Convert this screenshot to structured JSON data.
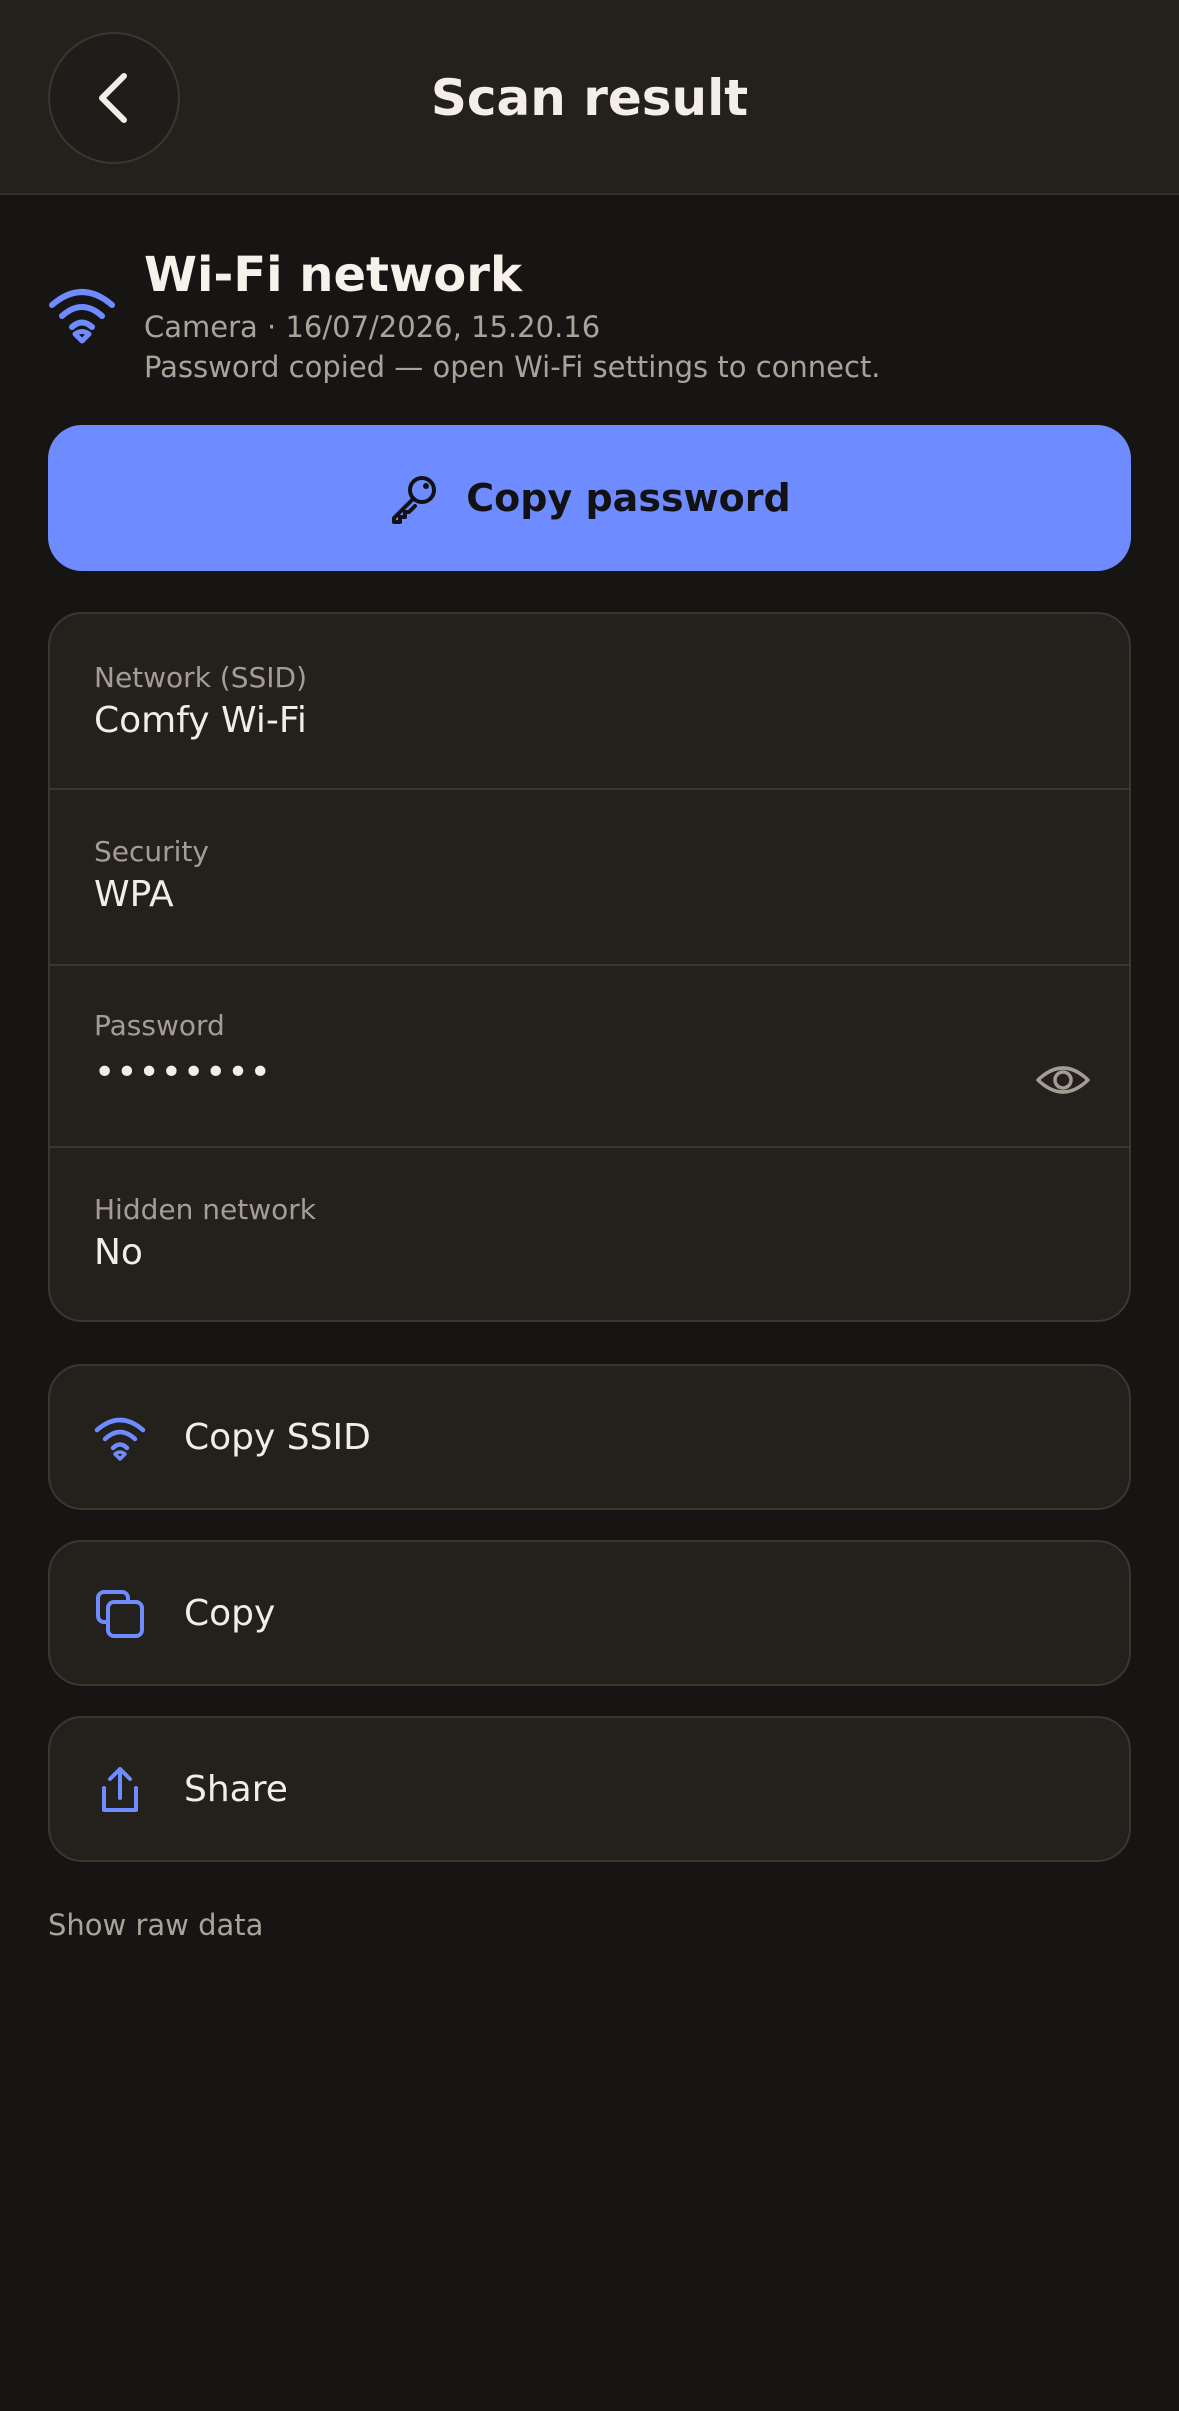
{
  "header": {
    "title": "Scan result",
    "back_icon": "chevron-left-icon"
  },
  "summary": {
    "icon": "wifi-icon",
    "title": "Wi-Fi network",
    "meta": "Camera · 16/07/2026, 15.20.16",
    "note": "Password copied — open Wi-Fi settings to connect."
  },
  "primary_action": {
    "icon": "key-icon",
    "label": "Copy password"
  },
  "details": [
    {
      "label": "Network (SSID)",
      "value": "Comfy Wi-Fi"
    },
    {
      "label": "Security",
      "value": "WPA"
    },
    {
      "label": "Password",
      "value": "••••••••",
      "toggle_icon": "eye-icon"
    },
    {
      "label": "Hidden network",
      "value": "No"
    }
  ],
  "actions": [
    {
      "icon": "wifi-icon",
      "label": "Copy SSID"
    },
    {
      "icon": "copy-icon",
      "label": "Copy"
    },
    {
      "icon": "share-icon",
      "label": "Share"
    }
  ],
  "raw_link": "Show raw data",
  "colors": {
    "accent": "#6e8cff",
    "background": "#161514",
    "surface": "#24211d",
    "border": "#3a3630",
    "muted_text": "#a9a39a"
  }
}
